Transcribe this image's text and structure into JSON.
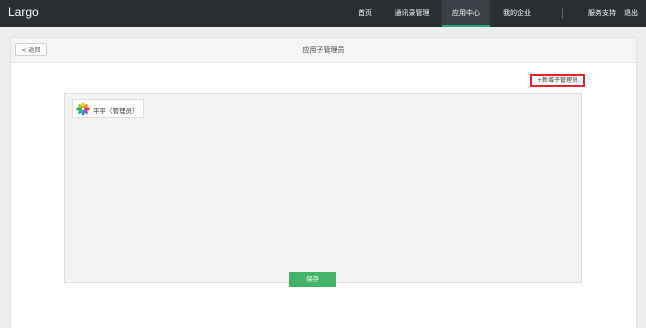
{
  "app": {
    "logo": "Largo"
  },
  "nav": {
    "items": [
      {
        "label": "首页"
      },
      {
        "label": "通讯录管理"
      },
      {
        "label": "应用中心"
      },
      {
        "label": "我的企业"
      }
    ],
    "right": [
      {
        "label": "服务支持"
      },
      {
        "label": "退出"
      }
    ],
    "active_color": "#20a87a"
  },
  "header": {
    "back_label": "返回",
    "title": "应用子管理员"
  },
  "actions": {
    "add_admin_label": "+新增子管理员",
    "save_label": "保存"
  },
  "admins": [
    {
      "name": "平平（管理员）",
      "avatar_icon": "colorful-flower-icon"
    }
  ]
}
